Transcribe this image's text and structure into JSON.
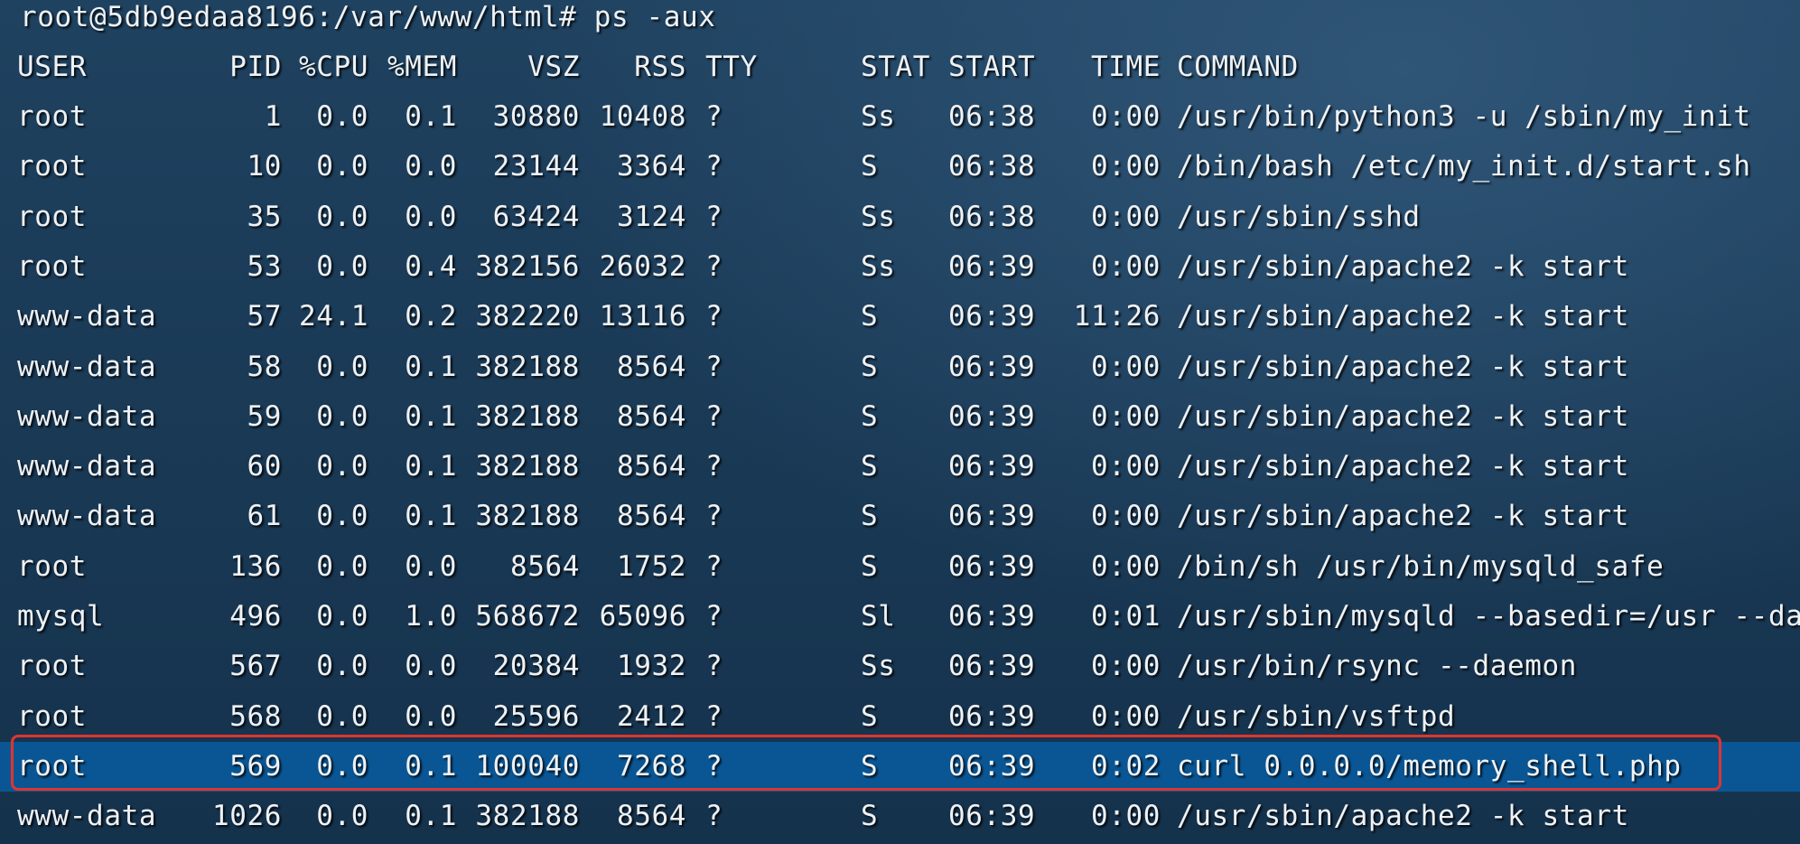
{
  "prompt": {
    "text": "root@5db9edaa8196:/var/www/html# ps -aux"
  },
  "headers": {
    "user": "USER",
    "pid": "PID",
    "cpu": "%CPU",
    "mem": "%MEM",
    "vsz": "VSZ",
    "rss": "RSS",
    "tty": "TTY",
    "stat": "STAT",
    "start": "START",
    "time": "TIME",
    "command": "COMMAND"
  },
  "rows": [
    {
      "user": "root",
      "pid": "1",
      "cpu": "0.0",
      "mem": "0.1",
      "vsz": "30880",
      "rss": "10408",
      "tty": "?",
      "stat": "Ss",
      "start": "06:38",
      "time": "0:00",
      "command": "/usr/bin/python3 -u /sbin/my_init"
    },
    {
      "user": "root",
      "pid": "10",
      "cpu": "0.0",
      "mem": "0.0",
      "vsz": "23144",
      "rss": "3364",
      "tty": "?",
      "stat": "S",
      "start": "06:38",
      "time": "0:00",
      "command": "/bin/bash /etc/my_init.d/start.sh"
    },
    {
      "user": "root",
      "pid": "35",
      "cpu": "0.0",
      "mem": "0.0",
      "vsz": "63424",
      "rss": "3124",
      "tty": "?",
      "stat": "Ss",
      "start": "06:38",
      "time": "0:00",
      "command": "/usr/sbin/sshd"
    },
    {
      "user": "root",
      "pid": "53",
      "cpu": "0.0",
      "mem": "0.4",
      "vsz": "382156",
      "rss": "26032",
      "tty": "?",
      "stat": "Ss",
      "start": "06:39",
      "time": "0:00",
      "command": "/usr/sbin/apache2 -k start"
    },
    {
      "user": "www-data",
      "pid": "57",
      "cpu": "24.1",
      "mem": "0.2",
      "vsz": "382220",
      "rss": "13116",
      "tty": "?",
      "stat": "S",
      "start": "06:39",
      "time": "11:26",
      "command": "/usr/sbin/apache2 -k start"
    },
    {
      "user": "www-data",
      "pid": "58",
      "cpu": "0.0",
      "mem": "0.1",
      "vsz": "382188",
      "rss": "8564",
      "tty": "?",
      "stat": "S",
      "start": "06:39",
      "time": "0:00",
      "command": "/usr/sbin/apache2 -k start"
    },
    {
      "user": "www-data",
      "pid": "59",
      "cpu": "0.0",
      "mem": "0.1",
      "vsz": "382188",
      "rss": "8564",
      "tty": "?",
      "stat": "S",
      "start": "06:39",
      "time": "0:00",
      "command": "/usr/sbin/apache2 -k start"
    },
    {
      "user": "www-data",
      "pid": "60",
      "cpu": "0.0",
      "mem": "0.1",
      "vsz": "382188",
      "rss": "8564",
      "tty": "?",
      "stat": "S",
      "start": "06:39",
      "time": "0:00",
      "command": "/usr/sbin/apache2 -k start"
    },
    {
      "user": "www-data",
      "pid": "61",
      "cpu": "0.0",
      "mem": "0.1",
      "vsz": "382188",
      "rss": "8564",
      "tty": "?",
      "stat": "S",
      "start": "06:39",
      "time": "0:00",
      "command": "/usr/sbin/apache2 -k start"
    },
    {
      "user": "root",
      "pid": "136",
      "cpu": "0.0",
      "mem": "0.0",
      "vsz": "8564",
      "rss": "1752",
      "tty": "?",
      "stat": "S",
      "start": "06:39",
      "time": "0:00",
      "command": "/bin/sh /usr/bin/mysqld_safe"
    },
    {
      "user": "mysql",
      "pid": "496",
      "cpu": "0.0",
      "mem": "1.0",
      "vsz": "568672",
      "rss": "65096",
      "tty": "?",
      "stat": "Sl",
      "start": "06:39",
      "time": "0:01",
      "command": "/usr/sbin/mysqld --basedir=/usr --da"
    },
    {
      "user": "root",
      "pid": "567",
      "cpu": "0.0",
      "mem": "0.0",
      "vsz": "20384",
      "rss": "1932",
      "tty": "?",
      "stat": "Ss",
      "start": "06:39",
      "time": "0:00",
      "command": "/usr/bin/rsync --daemon"
    },
    {
      "user": "root",
      "pid": "568",
      "cpu": "0.0",
      "mem": "0.0",
      "vsz": "25596",
      "rss": "2412",
      "tty": "?",
      "stat": "S",
      "start": "06:39",
      "time": "0:00",
      "command": "/usr/sbin/vsftpd"
    },
    {
      "user": "root",
      "pid": "569",
      "cpu": "0.0",
      "mem": "0.1",
      "vsz": "100040",
      "rss": "7268",
      "tty": "?",
      "stat": "S",
      "start": "06:39",
      "time": "0:02",
      "command": "curl 0.0.0.0/memory_shell.php",
      "selected": true
    },
    {
      "user": "www-data",
      "pid": "1026",
      "cpu": "0.0",
      "mem": "0.1",
      "vsz": "382188",
      "rss": "8564",
      "tty": "?",
      "stat": "S",
      "start": "06:39",
      "time": "0:00",
      "command": "/usr/sbin/apache2 -k start"
    }
  ],
  "colors": {
    "selection": "#0a5694",
    "highlight_border": "#e0342f",
    "text": "#eef2f6"
  }
}
